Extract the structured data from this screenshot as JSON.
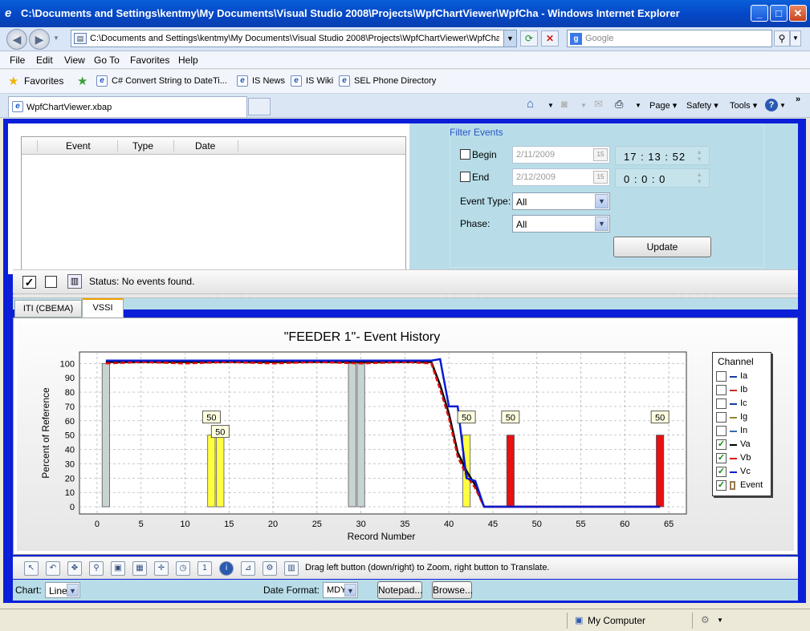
{
  "window": {
    "title": "C:\\Documents and Settings\\kentmy\\My Documents\\Visual Studio 2008\\Projects\\WpfChartViewer\\WpfCha - Windows Internet Explorer"
  },
  "address": {
    "url": "C:\\Documents and Settings\\kentmy\\My Documents\\Visual Studio 2008\\Projects\\WpfChartViewer\\WpfChart'",
    "search_placeholder": "Google"
  },
  "menu": [
    "File",
    "Edit",
    "View",
    "Go To",
    "Favorites",
    "Help"
  ],
  "favorites": {
    "label": "Favorites",
    "links": [
      "C# Convert String to DateTi...",
      "IS News",
      "IS Wiki",
      "SEL Phone Directory"
    ]
  },
  "tabs": {
    "active": "WpfChartViewer.xbap"
  },
  "commands": {
    "page": "Page",
    "safety": "Safety",
    "tools": "Tools"
  },
  "events_list": {
    "columns": [
      "Event",
      "Type",
      "Date"
    ]
  },
  "filter": {
    "title": "Filter Events",
    "begin_label": "Begin",
    "end_label": "End",
    "begin_date": "2/11/2009",
    "end_date": "2/12/2009",
    "begin_time": "17 : 13 : 52",
    "end_time": "0 : 0 : 0",
    "event_type_label": "Event Type:",
    "event_type_value": "All",
    "phase_label": "Phase:",
    "phase_value": "All",
    "update_button": "Update",
    "calendar_icon_text": "15"
  },
  "status": {
    "text": "Status: No events found."
  },
  "chart_tabs": [
    "ITI (CBEMA)",
    "VSSI"
  ],
  "chart_data": {
    "type": "line",
    "title": "\"FEEDER 1\"- Event History",
    "xlabel": "Record Number",
    "ylabel": "Percent of Reference",
    "xlim": [
      -2,
      67
    ],
    "ylim": [
      -5,
      108
    ],
    "x_ticks": [
      0,
      5,
      10,
      15,
      20,
      25,
      30,
      35,
      40,
      45,
      50,
      55,
      60,
      65
    ],
    "y_ticks": [
      0,
      10,
      20,
      30,
      40,
      50,
      60,
      70,
      80,
      90,
      100
    ],
    "grid": true,
    "legend_title": "Channel",
    "legend": [
      {
        "name": "Ia",
        "checked": false,
        "color": "#1a3aa0"
      },
      {
        "name": "Ib",
        "checked": false,
        "color": "#c03030"
      },
      {
        "name": "Ic",
        "checked": false,
        "color": "#1a3aa0"
      },
      {
        "name": "Ig",
        "checked": false,
        "color": "#8a8a30"
      },
      {
        "name": "In",
        "checked": false,
        "color": "#3a6ab0"
      },
      {
        "name": "Va",
        "checked": true,
        "color": "#000000"
      },
      {
        "name": "Vb",
        "checked": true,
        "color": "#e01010"
      },
      {
        "name": "Vc",
        "checked": true,
        "color": "#0a1ad0"
      },
      {
        "name": "Event",
        "checked": true,
        "color": "#9a7a50"
      }
    ],
    "series": [
      {
        "name": "Va",
        "color": "#000000",
        "x": [
          1,
          5,
          10,
          15,
          20,
          25,
          30,
          35,
          38,
          39,
          40,
          41,
          42,
          43,
          44,
          50,
          55,
          60,
          64
        ],
        "y": [
          101,
          101,
          101,
          101,
          101,
          101,
          101,
          101,
          101,
          85,
          65,
          38,
          25,
          15,
          0,
          0,
          0,
          0,
          0
        ]
      },
      {
        "name": "Vb",
        "color": "#e01010",
        "x": [
          1,
          5,
          10,
          15,
          20,
          25,
          30,
          35,
          38,
          39,
          40,
          41,
          42,
          43,
          44,
          50,
          55,
          60,
          64
        ],
        "y": [
          100,
          101,
          100,
          101,
          100,
          101,
          100,
          101,
          100,
          82,
          62,
          35,
          22,
          13,
          0,
          0,
          0,
          0,
          0
        ]
      },
      {
        "name": "Vc",
        "color": "#0a1ad0",
        "x": [
          1,
          5,
          10,
          15,
          20,
          25,
          30,
          35,
          38,
          39,
          40,
          41,
          42,
          43,
          44,
          50,
          55,
          60,
          64
        ],
        "y": [
          102,
          102,
          102,
          102,
          102,
          102,
          102,
          102,
          102,
          103,
          70,
          70,
          20,
          18,
          0,
          0,
          0,
          0,
          0
        ]
      }
    ],
    "event_bars": [
      {
        "x": 1,
        "y": 100,
        "color": "#c8d4d0"
      },
      {
        "x": 13,
        "y": 50,
        "color": "#ffff40",
        "label": "50"
      },
      {
        "x": 14,
        "y": 50,
        "color": "#ffff40",
        "label": "50"
      },
      {
        "x": 29,
        "y": 100,
        "color": "#c8d4d0"
      },
      {
        "x": 30,
        "y": 100,
        "color": "#c8d4d0"
      },
      {
        "x": 42,
        "y": 50,
        "color": "#ffff40",
        "label": "50"
      },
      {
        "x": 47,
        "y": 50,
        "color": "#e81010",
        "label": "50"
      },
      {
        "x": 64,
        "y": 50,
        "color": "#e81010",
        "label": "50"
      }
    ]
  },
  "chart_toolbar": {
    "hint": "Drag left button (down/right) to Zoom, right button to Translate."
  },
  "bottom": {
    "chart_label": "Chart:",
    "chart_value": "Line",
    "date_format_label": "Date Format:",
    "date_format_value": "MDY",
    "notepad_button": "Notepad...",
    "browse_button": "Browse..."
  },
  "ie_status": {
    "zone": "My Computer"
  }
}
